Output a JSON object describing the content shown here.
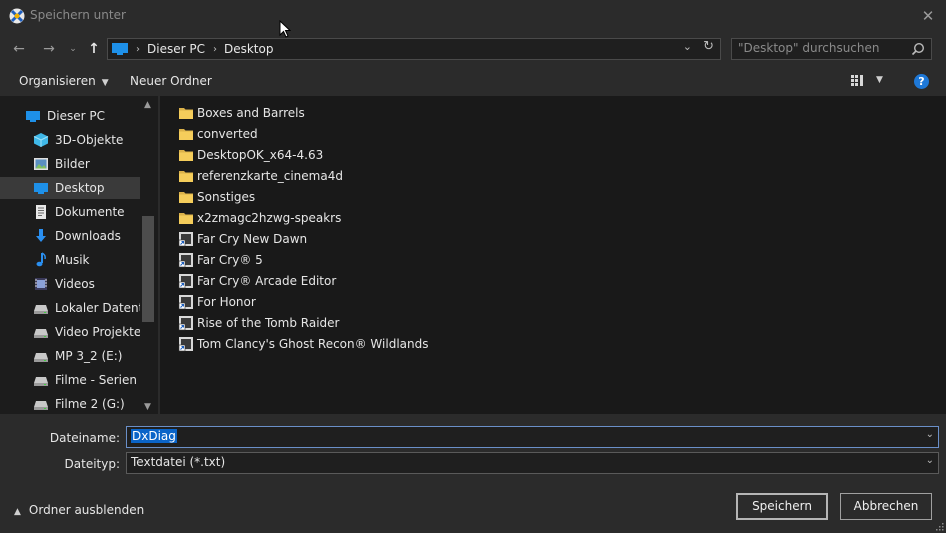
{
  "window": {
    "title": "Speichern unter"
  },
  "address": {
    "crumbs": [
      "Dieser PC",
      "Desktop"
    ]
  },
  "search": {
    "placeholder": "\"Desktop\" durchsuchen"
  },
  "toolbar": {
    "organize": "Organisieren",
    "new_folder": "Neuer Ordner",
    "help": "?"
  },
  "nav": {
    "items": [
      {
        "label": "Dieser PC",
        "icon": "pc-icon",
        "indent": 0
      },
      {
        "label": "3D-Objekte",
        "icon": "cube-icon",
        "indent": 1
      },
      {
        "label": "Bilder",
        "icon": "pictures-icon",
        "indent": 1
      },
      {
        "label": "Desktop",
        "icon": "desktop-icon",
        "indent": 1,
        "selected": true
      },
      {
        "label": "Dokumente",
        "icon": "documents-icon",
        "indent": 1
      },
      {
        "label": "Downloads",
        "icon": "download-icon",
        "indent": 1
      },
      {
        "label": "Musik",
        "icon": "music-icon",
        "indent": 1
      },
      {
        "label": "Videos",
        "icon": "videos-icon",
        "indent": 1
      },
      {
        "label": "Lokaler Datenträ",
        "icon": "drive-icon",
        "indent": 1
      },
      {
        "label": "Video Projekte (I",
        "icon": "drive-icon",
        "indent": 1
      },
      {
        "label": "MP 3_2 (E:)",
        "icon": "drive-icon",
        "indent": 1
      },
      {
        "label": "Filme - Serien (F:",
        "icon": "drive-icon",
        "indent": 1
      },
      {
        "label": "Filme 2 (G:)",
        "icon": "drive-icon",
        "indent": 1
      }
    ]
  },
  "files": [
    {
      "name": "Boxes and Barrels",
      "icon": "folder-icon"
    },
    {
      "name": "converted",
      "icon": "folder-icon"
    },
    {
      "name": "DesktopOK_x64-4.63",
      "icon": "folder-icon"
    },
    {
      "name": "referenzkarte_cinema4d",
      "icon": "folder-icon"
    },
    {
      "name": "Sonstiges",
      "icon": "folder-icon"
    },
    {
      "name": "x2zmagc2hzwg-speakrs",
      "icon": "folder-icon"
    },
    {
      "name": "Far Cry New Dawn",
      "icon": "game-shortcut-icon"
    },
    {
      "name": "Far Cry® 5",
      "icon": "game-shortcut-icon"
    },
    {
      "name": "Far Cry® Arcade Editor",
      "icon": "game-shortcut-icon"
    },
    {
      "name": "For Honor",
      "icon": "game-shortcut-icon"
    },
    {
      "name": "Rise of the Tomb Raider",
      "icon": "game-shortcut-icon"
    },
    {
      "name": "Tom Clancy's Ghost Recon® Wildlands",
      "icon": "game-shortcut-icon"
    }
  ],
  "form": {
    "filename_label": "Dateiname:",
    "filename_value": "DxDiag",
    "filetype_label": "Dateityp:",
    "filetype_value": "Textdatei (*.txt)"
  },
  "footer": {
    "hide_folders": "Ordner ausblenden",
    "save": "Speichern",
    "cancel": "Abbrechen"
  },
  "colors": {
    "accent": "#1e78d7",
    "selection": "#0a64c8",
    "folder": "#f5cd5b"
  }
}
